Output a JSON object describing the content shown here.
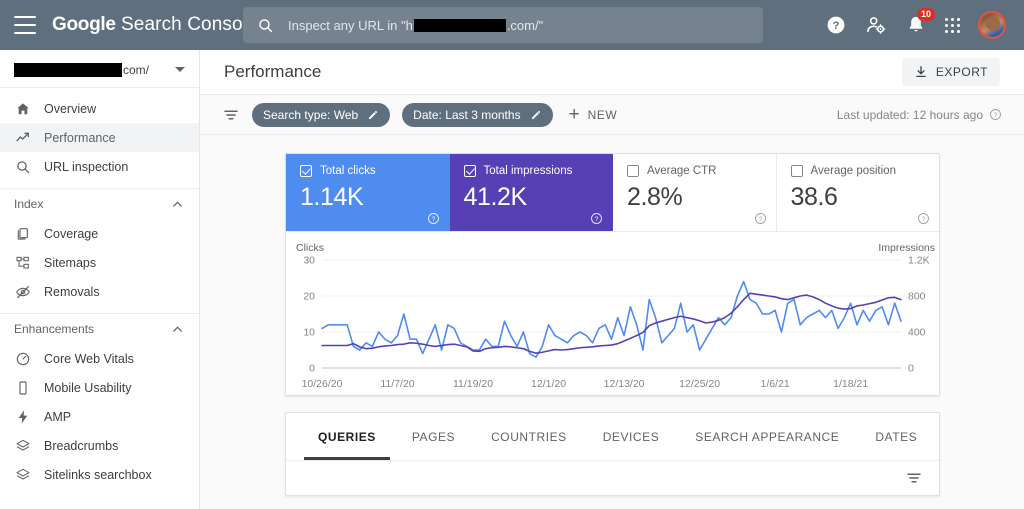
{
  "topbar": {
    "menu_icon": "hamburger-menu-icon",
    "brand_bold": "Google",
    "brand_rest": " Search Console",
    "search": {
      "prefix": "Inspect any URL in \"h",
      "suffix": ".com/\"",
      "icon": "search-icon"
    },
    "help_icon": "help-icon",
    "account_settings_icon": "account-settings-icon",
    "notifications_icon": "notifications-bell-icon",
    "notifications_count": "10",
    "apps_icon": "apps-grid-icon",
    "avatar_icon": "user-avatar"
  },
  "sidebar": {
    "property": {
      "suffix": "com/",
      "dropdown_icon": "chevron-down-icon"
    },
    "primary": [
      {
        "label": "Overview",
        "icon": "home-icon",
        "active": false
      },
      {
        "label": "Performance",
        "icon": "trending-up-icon",
        "active": true
      },
      {
        "label": "URL inspection",
        "icon": "search-icon",
        "active": false
      }
    ],
    "groups": [
      {
        "title": "Index",
        "collapse_icon": "chevron-up-icon",
        "items": [
          {
            "label": "Coverage",
            "icon": "coverage-pages-icon"
          },
          {
            "label": "Sitemaps",
            "icon": "sitemap-icon"
          },
          {
            "label": "Removals",
            "icon": "removals-eye-off-icon"
          }
        ]
      },
      {
        "title": "Enhancements",
        "collapse_icon": "chevron-up-icon",
        "items": [
          {
            "label": "Core Web Vitals",
            "icon": "speedometer-icon"
          },
          {
            "label": "Mobile Usability",
            "icon": "mobile-phone-icon"
          },
          {
            "label": "AMP",
            "icon": "lightning-bolt-icon"
          },
          {
            "label": "Breadcrumbs",
            "icon": "layers-icon"
          },
          {
            "label": "Sitelinks searchbox",
            "icon": "layers-icon"
          }
        ]
      }
    ]
  },
  "page": {
    "title": "Performance",
    "export_label": "EXPORT",
    "export_icon": "download-icon"
  },
  "filters": {
    "filter_icon": "filter-lines-icon",
    "chips": [
      {
        "label": "Search type: Web",
        "edit_icon": "pencil-icon"
      },
      {
        "label": "Date: Last 3 months",
        "edit_icon": "pencil-icon"
      }
    ],
    "new_label": "NEW",
    "new_icon": "plus-icon",
    "last_updated": "Last updated: 12 hours ago",
    "last_updated_icon": "help-icon"
  },
  "metrics": [
    {
      "label": "Total clicks",
      "value": "1.14K",
      "checked": true,
      "style": "sel-clicks",
      "help_icon": "help-icon"
    },
    {
      "label": "Total impressions",
      "value": "41.2K",
      "checked": true,
      "style": "sel-impr",
      "help_icon": "help-icon"
    },
    {
      "label": "Average CTR",
      "value": "2.8%",
      "checked": false,
      "style": "",
      "help_icon": "help-icon"
    },
    {
      "label": "Average position",
      "value": "38.6",
      "checked": false,
      "style": "",
      "help_icon": "help-icon"
    }
  ],
  "tabs": [
    {
      "label": "QUERIES",
      "active": true
    },
    {
      "label": "PAGES",
      "active": false
    },
    {
      "label": "COUNTRIES",
      "active": false
    },
    {
      "label": "DEVICES",
      "active": false
    },
    {
      "label": "SEARCH APPEARANCE",
      "active": false
    },
    {
      "label": "DATES",
      "active": false
    }
  ],
  "table_toolbar": {
    "filter_icon": "filter-lines-icon"
  },
  "colors": {
    "clicks": "#4e8cf0",
    "impressions": "#5540b5",
    "topbar": "#5f6f7e",
    "chip": "#5f6f7e",
    "badge": "#d93025"
  },
  "chart_data": {
    "type": "line",
    "title": "",
    "ylabel": "Clicks",
    "y2label": "Impressions",
    "xlabel": "",
    "ylim": [
      0,
      30
    ],
    "y2lim": [
      0,
      1200
    ],
    "yticks": [
      "0",
      "10",
      "20",
      "30"
    ],
    "y2ticks": [
      "0",
      "400",
      "800",
      "1.2K"
    ],
    "grid": true,
    "legend_position": "none",
    "x_start": "10/26/20",
    "x_end": "1/24/21",
    "xticks": [
      "10/26/20",
      "11/7/20",
      "11/19/20",
      "12/1/20",
      "12/13/20",
      "12/25/20",
      "1/6/21",
      "1/18/21"
    ],
    "xtick_indices": [
      0,
      12,
      24,
      36,
      48,
      60,
      72,
      84
    ],
    "series": [
      {
        "name": "Clicks",
        "color": "#4e8cf0",
        "axis": "left",
        "values": [
          11,
          12,
          12,
          12,
          12,
          6,
          5,
          7,
          6,
          10,
          8,
          7,
          9,
          15,
          8,
          8,
          4,
          8,
          12,
          5,
          12,
          11,
          7,
          6,
          5,
          5,
          8,
          6,
          6,
          13,
          9,
          6,
          10,
          4,
          3,
          6,
          12,
          9,
          8,
          7,
          9,
          10,
          9,
          7,
          11,
          12,
          8,
          14,
          9,
          17,
          12,
          5,
          19,
          14,
          7,
          9,
          11,
          18,
          10,
          12,
          5,
          8,
          11,
          14,
          12,
          14,
          20,
          24,
          19,
          18,
          15,
          15,
          16,
          10,
          18,
          19,
          12,
          14,
          15,
          16,
          14,
          16,
          11,
          14,
          18,
          12,
          16,
          13,
          16,
          17,
          12,
          18,
          13
        ]
      },
      {
        "name": "Impressions",
        "color": "#5540b5",
        "axis": "right",
        "values": [
          250,
          250,
          250,
          250,
          250,
          270,
          235,
          215,
          220,
          235,
          245,
          250,
          260,
          265,
          280,
          275,
          265,
          250,
          240,
          250,
          260,
          265,
          250,
          235,
          190,
          185,
          215,
          225,
          230,
          240,
          235,
          225,
          215,
          185,
          165,
          175,
          190,
          205,
          200,
          205,
          215,
          225,
          230,
          235,
          245,
          250,
          255,
          270,
          300,
          330,
          360,
          395,
          470,
          500,
          520,
          540,
          560,
          575,
          560,
          545,
          525,
          500,
          510,
          530,
          560,
          610,
          680,
          760,
          830,
          820,
          810,
          800,
          790,
          770,
          760,
          780,
          800,
          810,
          790,
          760,
          720,
          690,
          665,
          655,
          660,
          690,
          700,
          715,
          730,
          755,
          780,
          785,
          760
        ]
      }
    ]
  }
}
